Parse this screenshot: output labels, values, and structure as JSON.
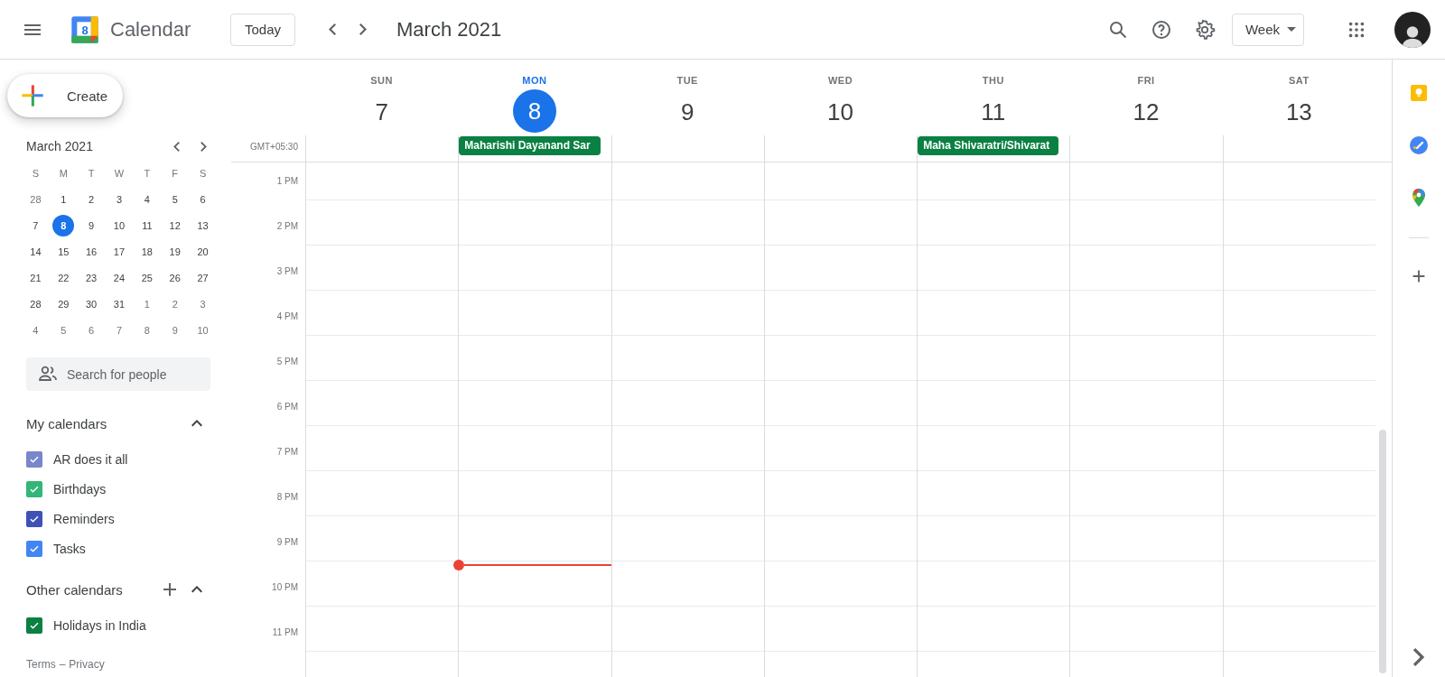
{
  "app": {
    "logo_day": "8",
    "title": "Calendar"
  },
  "toolbar": {
    "today": "Today",
    "period": "March 2021",
    "view": "Week"
  },
  "sidebar": {
    "create": "Create",
    "mini_calendar": {
      "title": "March 2021",
      "weekdays": [
        "S",
        "M",
        "T",
        "W",
        "T",
        "F",
        "S"
      ],
      "weeks": [
        [
          {
            "label": "28",
            "in_month": false,
            "selected": false
          },
          {
            "label": "1",
            "in_month": true,
            "selected": false
          },
          {
            "label": "2",
            "in_month": true,
            "selected": false
          },
          {
            "label": "3",
            "in_month": true,
            "selected": false
          },
          {
            "label": "4",
            "in_month": true,
            "selected": false
          },
          {
            "label": "5",
            "in_month": true,
            "selected": false
          },
          {
            "label": "6",
            "in_month": true,
            "selected": false
          }
        ],
        [
          {
            "label": "7",
            "in_month": true,
            "selected": false
          },
          {
            "label": "8",
            "in_month": true,
            "selected": true
          },
          {
            "label": "9",
            "in_month": true,
            "selected": false
          },
          {
            "label": "10",
            "in_month": true,
            "selected": false
          },
          {
            "label": "11",
            "in_month": true,
            "selected": false
          },
          {
            "label": "12",
            "in_month": true,
            "selected": false
          },
          {
            "label": "13",
            "in_month": true,
            "selected": false
          }
        ],
        [
          {
            "label": "14",
            "in_month": true,
            "selected": false
          },
          {
            "label": "15",
            "in_month": true,
            "selected": false
          },
          {
            "label": "16",
            "in_month": true,
            "selected": false
          },
          {
            "label": "17",
            "in_month": true,
            "selected": false
          },
          {
            "label": "18",
            "in_month": true,
            "selected": false
          },
          {
            "label": "19",
            "in_month": true,
            "selected": false
          },
          {
            "label": "20",
            "in_month": true,
            "selected": false
          }
        ],
        [
          {
            "label": "21",
            "in_month": true,
            "selected": false
          },
          {
            "label": "22",
            "in_month": true,
            "selected": false
          },
          {
            "label": "23",
            "in_month": true,
            "selected": false
          },
          {
            "label": "24",
            "in_month": true,
            "selected": false
          },
          {
            "label": "25",
            "in_month": true,
            "selected": false
          },
          {
            "label": "26",
            "in_month": true,
            "selected": false
          },
          {
            "label": "27",
            "in_month": true,
            "selected": false
          }
        ],
        [
          {
            "label": "28",
            "in_month": true,
            "selected": false
          },
          {
            "label": "29",
            "in_month": true,
            "selected": false
          },
          {
            "label": "30",
            "in_month": true,
            "selected": false
          },
          {
            "label": "31",
            "in_month": true,
            "selected": false
          },
          {
            "label": "1",
            "in_month": false,
            "selected": false
          },
          {
            "label": "2",
            "in_month": false,
            "selected": false
          },
          {
            "label": "3",
            "in_month": false,
            "selected": false
          }
        ],
        [
          {
            "label": "4",
            "in_month": false,
            "selected": false
          },
          {
            "label": "5",
            "in_month": false,
            "selected": false
          },
          {
            "label": "6",
            "in_month": false,
            "selected": false
          },
          {
            "label": "7",
            "in_month": false,
            "selected": false
          },
          {
            "label": "8",
            "in_month": false,
            "selected": false
          },
          {
            "label": "9",
            "in_month": false,
            "selected": false
          },
          {
            "label": "10",
            "in_month": false,
            "selected": false
          }
        ]
      ]
    },
    "search": {
      "placeholder": "Search for people"
    },
    "my_calendars": {
      "title": "My calendars",
      "expanded": true,
      "items": [
        {
          "label": "AR does it all",
          "checked": true,
          "color": "#7986cb"
        },
        {
          "label": "Birthdays",
          "checked": true,
          "color": "#33b679"
        },
        {
          "label": "Reminders",
          "checked": true,
          "color": "#3f51b5"
        },
        {
          "label": "Tasks",
          "checked": true,
          "color": "#4285f4"
        }
      ]
    },
    "other_calendars": {
      "title": "Other calendars",
      "expanded": true,
      "items": [
        {
          "label": "Holidays in India",
          "checked": true,
          "color": "#0b8043"
        }
      ]
    },
    "footer": {
      "terms": "Terms",
      "separator": "–",
      "privacy": "Privacy"
    }
  },
  "week": {
    "timezone": "GMT+05:30",
    "days": [
      {
        "name": "SUN",
        "number": "7",
        "selected": false,
        "current_time": false
      },
      {
        "name": "MON",
        "number": "8",
        "selected": true,
        "current_time": true,
        "all_day_events": [
          {
            "title": "Maharishi Dayanand Sar",
            "color": "#0b8043"
          }
        ]
      },
      {
        "name": "TUE",
        "number": "9",
        "selected": false,
        "current_time": false
      },
      {
        "name": "WED",
        "number": "10",
        "selected": false,
        "current_time": false
      },
      {
        "name": "THU",
        "number": "11",
        "selected": false,
        "current_time": false,
        "all_day_events": [
          {
            "title": "Maha Shivaratri/Shivarat",
            "color": "#0b8043"
          }
        ]
      },
      {
        "name": "FRI",
        "number": "12",
        "selected": false,
        "current_time": false
      },
      {
        "name": "SAT",
        "number": "13",
        "selected": false,
        "current_time": false
      }
    ],
    "hours": [
      "1 PM",
      "2 PM",
      "3 PM",
      "4 PM",
      "5 PM",
      "6 PM",
      "7 PM",
      "8 PM",
      "9 PM",
      "10 PM",
      "11 PM"
    ]
  }
}
